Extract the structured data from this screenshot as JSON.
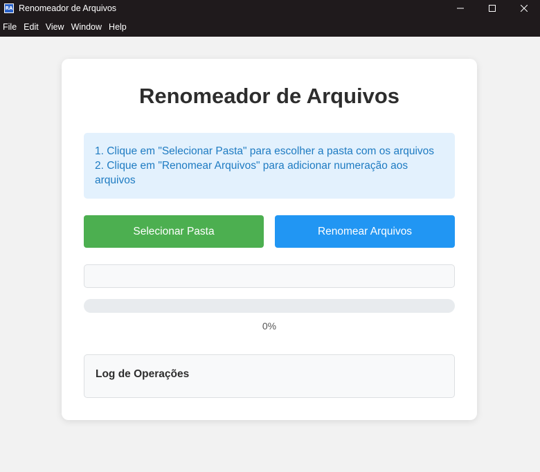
{
  "window": {
    "icon_text": "RA",
    "title": "Renomeador de Arquivos"
  },
  "menu": {
    "items": [
      {
        "label": "File"
      },
      {
        "label": "Edit"
      },
      {
        "label": "View"
      },
      {
        "label": "Window"
      },
      {
        "label": "Help"
      }
    ]
  },
  "main": {
    "title": "Renomeador de Arquivos",
    "instructions": [
      "1. Clique em \"Selecionar Pasta\" para escolher a pasta com os arquivos",
      "2. Clique em \"Renomear Arquivos\" para adicionar numeração aos arquivos"
    ],
    "select_button_label": "Selecionar Pasta",
    "rename_button_label": "Renomear Arquivos",
    "folder_path_value": "",
    "progress_fraction": 0,
    "progress_label": "0%",
    "log_title": "Log de Operações"
  },
  "colors": {
    "titlebar_bg": "#1f1a1c",
    "select_button": "#4caf50",
    "rename_button": "#2196f3",
    "instructions_bg": "#e3f1fd",
    "instructions_text": "#1e7bc2"
  },
  "icons": {
    "minimize": "minimize-icon",
    "maximize": "maximize-icon",
    "close": "close-icon"
  }
}
